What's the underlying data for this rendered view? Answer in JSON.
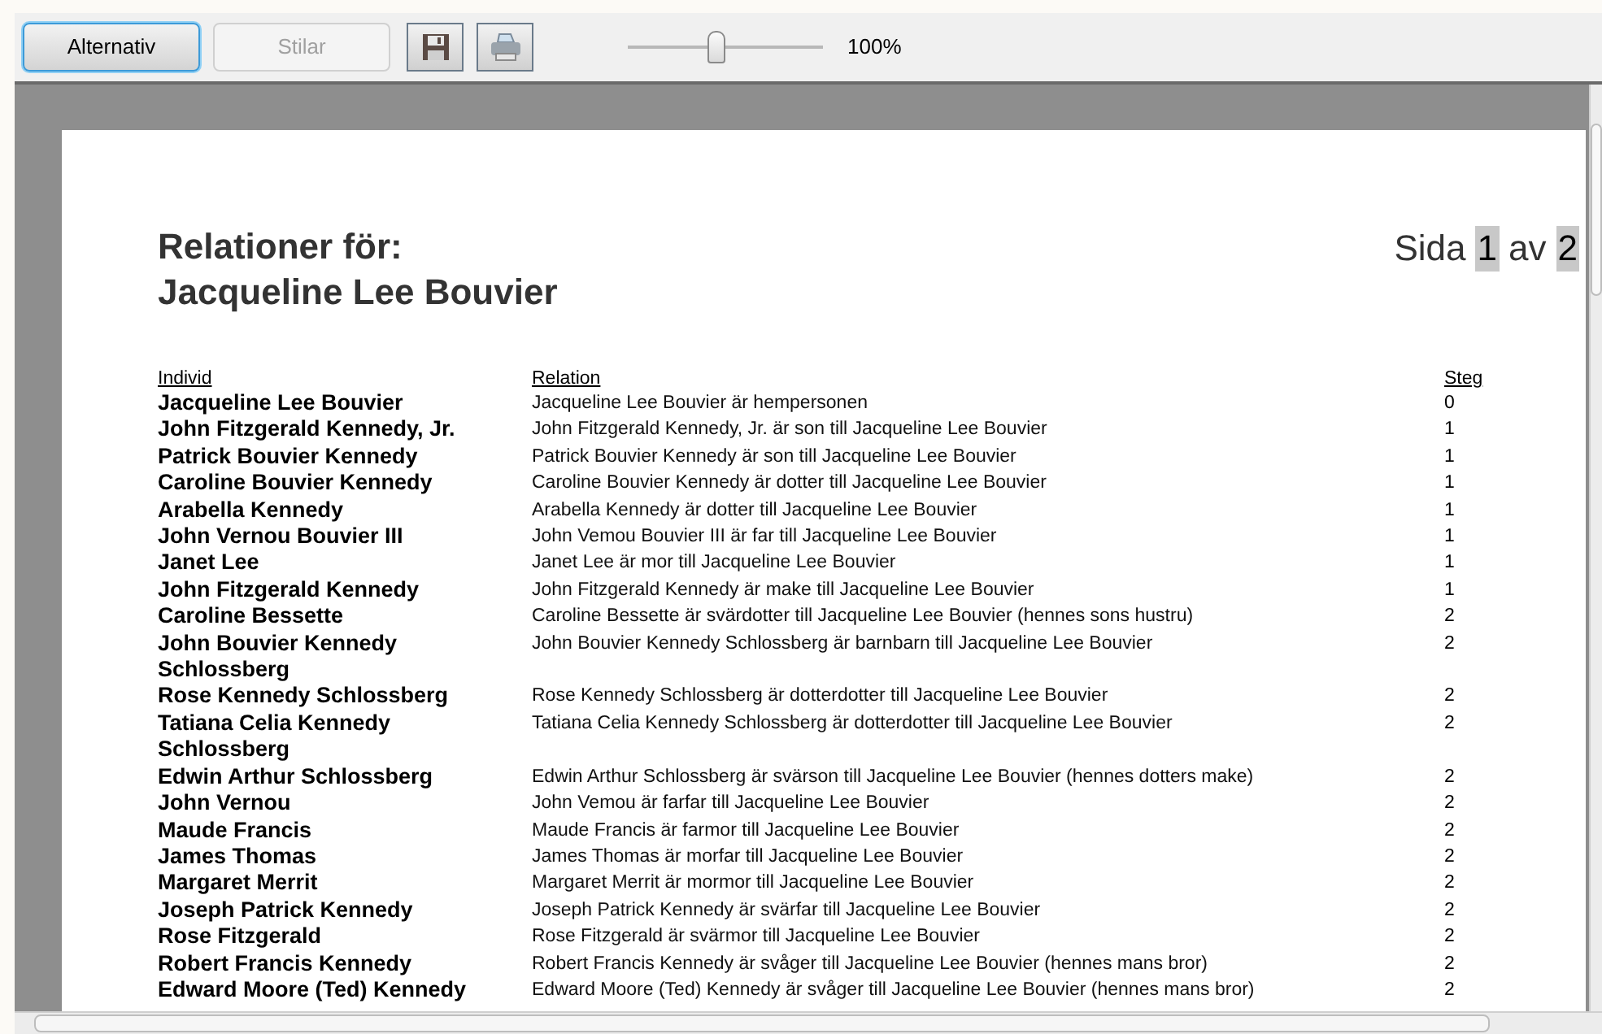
{
  "toolbar": {
    "buttons": [
      {
        "label": "Alternativ",
        "disabled": false,
        "selected": true
      },
      {
        "label": "Stilar",
        "disabled": true,
        "selected": false
      }
    ],
    "zoom": {
      "level": 0.45,
      "reading": "100%"
    }
  },
  "page": {
    "title_lines": [
      "Relationer för:",
      "Jacqueline Lee Bouvier"
    ],
    "page_label": "Sida",
    "page_current": "1",
    "page_of": "av",
    "page_total": "2",
    "table": {
      "columns": [
        "Individ",
        "Relation",
        "Steg"
      ],
      "rows": [
        {
          "individ": "Jacqueline Lee Bouvier",
          "relation": "Jacqueline Lee Bouvier är hempersonen",
          "steg": "0"
        },
        {
          "individ": "John Fitzgerald Kennedy, Jr.",
          "relation": "John Fitzgerald Kennedy, Jr. är son till Jacqueline Lee Bouvier",
          "steg": "1"
        },
        {
          "individ": "Patrick Bouvier Kennedy",
          "relation": "Patrick Bouvier Kennedy är son till Jacqueline Lee Bouvier",
          "steg": "1"
        },
        {
          "individ": "Caroline Bouvier Kennedy",
          "relation": "Caroline Bouvier Kennedy är dotter till Jacqueline Lee Bouvier",
          "steg": "1"
        },
        {
          "individ": "Arabella Kennedy",
          "relation": "Arabella Kennedy är dotter till Jacqueline Lee Bouvier",
          "steg": "1"
        },
        {
          "individ": "John Vernou Bouvier III",
          "relation": "John Vemou Bouvier III är far till Jacqueline Lee Bouvier",
          "steg": "1"
        },
        {
          "individ": "Janet Lee",
          "relation": "Janet Lee är mor till Jacqueline Lee Bouvier",
          "steg": "1"
        },
        {
          "individ": "John Fitzgerald Kennedy",
          "relation": "John Fitzgerald Kennedy är make till Jacqueline Lee Bouvier",
          "steg": "1"
        },
        {
          "individ": "Caroline Bessette",
          "relation": "Caroline Bessette är svärdotter till Jacqueline Lee Bouvier (hennes sons hustru)",
          "steg": "2"
        },
        {
          "individ": "John Bouvier Kennedy Schlossberg",
          "relation": "John Bouvier Kennedy Schlossberg är barnbarn till Jacqueline Lee Bouvier",
          "steg": "2"
        },
        {
          "individ": "Rose Kennedy Schlossberg",
          "relation": "Rose Kennedy Schlossberg är dotterdotter till Jacqueline Lee Bouvier",
          "steg": "2"
        },
        {
          "individ": "Tatiana Celia Kennedy Schlossberg",
          "relation": "Tatiana Celia Kennedy Schlossberg är dotterdotter till Jacqueline Lee Bouvier",
          "steg": "2"
        },
        {
          "individ": "Edwin Arthur Schlossberg",
          "relation": "Edwin Arthur Schlossberg är svärson till Jacqueline Lee Bouvier (hennes dotters make)",
          "steg": "2"
        },
        {
          "individ": "John Vernou",
          "relation": "John Vemou är farfar till Jacqueline Lee Bouvier",
          "steg": "2"
        },
        {
          "individ": "Maude Francis",
          "relation": "Maude Francis är farmor till Jacqueline Lee Bouvier",
          "steg": "2"
        },
        {
          "individ": "James Thomas",
          "relation": "James Thomas är morfar till Jacqueline Lee Bouvier",
          "steg": "2"
        },
        {
          "individ": "Margaret Merrit",
          "relation": "Margaret Merrit är mormor till Jacqueline Lee Bouvier",
          "steg": "2"
        },
        {
          "individ": "Joseph Patrick Kennedy",
          "relation": "Joseph Patrick Kennedy är svärfar till Jacqueline Lee Bouvier",
          "steg": "2"
        },
        {
          "individ": "Rose Fitzgerald",
          "relation": "Rose Fitzgerald är svärmor till Jacqueline Lee Bouvier",
          "steg": "2"
        },
        {
          "individ": "Robert Francis Kennedy",
          "relation": "Robert Francis Kennedy är svåger till Jacqueline Lee Bouvier (hennes mans bror)",
          "steg": "2"
        },
        {
          "individ": "Edward Moore (Ted) Kennedy",
          "relation": "Edward Moore (Ted) Kennedy är svåger till Jacqueline Lee Bouvier (hennes mans bror)",
          "steg": "2"
        }
      ]
    }
  }
}
